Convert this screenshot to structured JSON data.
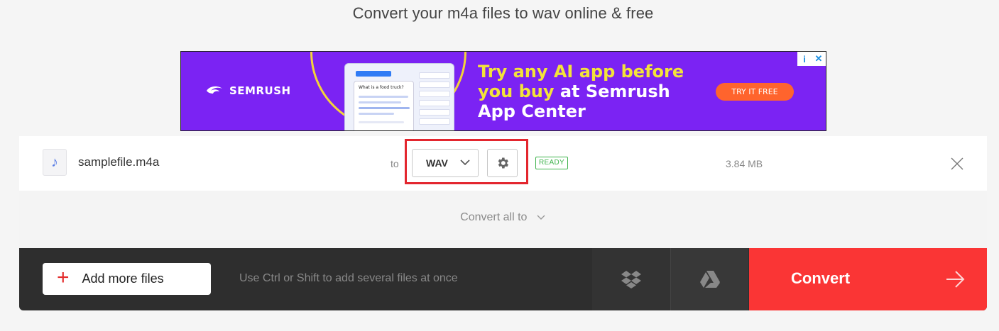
{
  "subtitle": "Convert your m4a files to wav online & free",
  "ad": {
    "brand": "SEMRUSH",
    "headline_yellow": "Try any AI app before",
    "headline_line2_yellow": "you buy",
    "headline_line2_white": "at Semrush",
    "headline_line3": "App Center",
    "cta": "TRY IT FREE",
    "mock_title": "What is a food truck?",
    "adchoices": "i",
    "ad_close": "✕"
  },
  "file": {
    "name": "samplefile.m4a",
    "to_label": "to",
    "format": "WAV",
    "status": "READY",
    "size": "3.84 MB"
  },
  "convert_all": {
    "label": "Convert all to"
  },
  "bottom": {
    "add_more": "Add more files",
    "hint": "Use Ctrl or Shift to add several files at once",
    "convert": "Convert"
  },
  "colors": {
    "accent_red": "#fa3535",
    "ready_green": "#3cb24a",
    "highlight": "#e3262e",
    "ad_purple": "#7b23f3"
  },
  "icons": {
    "file": "music-note-icon",
    "format_dropdown": "chevron-down-icon",
    "settings": "gear-icon",
    "remove": "close-icon",
    "add": "plus-icon",
    "dropbox": "dropbox-icon",
    "gdrive": "google-drive-icon",
    "convert": "arrow-right-icon"
  }
}
